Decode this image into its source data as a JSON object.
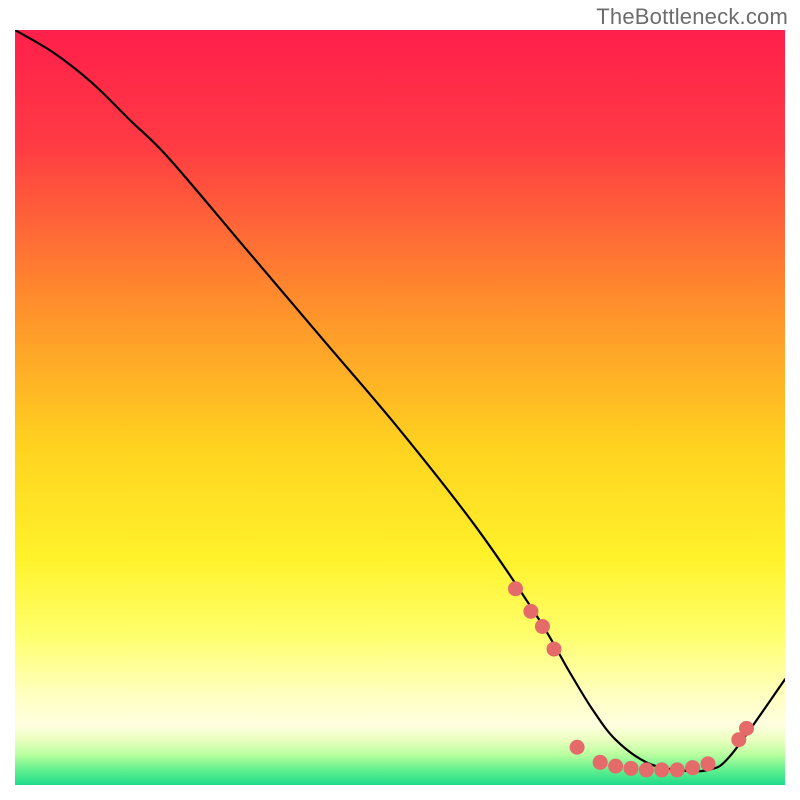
{
  "watermark": "TheBottleneck.com",
  "chart_data": {
    "type": "line",
    "title": "",
    "xlabel": "",
    "ylabel": "",
    "xlim": [
      0,
      100
    ],
    "ylim": [
      0,
      100
    ],
    "background_gradient_stops": [
      {
        "offset": 0,
        "color": "#ff1f4b"
      },
      {
        "offset": 15,
        "color": "#ff3a44"
      },
      {
        "offset": 35,
        "color": "#ff8a2d"
      },
      {
        "offset": 55,
        "color": "#ffd21f"
      },
      {
        "offset": 70,
        "color": "#fff22b"
      },
      {
        "offset": 80,
        "color": "#ffff6b"
      },
      {
        "offset": 88,
        "color": "#ffffc0"
      },
      {
        "offset": 92,
        "color": "#ffffe0"
      },
      {
        "offset": 94,
        "color": "#eaffc0"
      },
      {
        "offset": 96,
        "color": "#b8ff9e"
      },
      {
        "offset": 98,
        "color": "#63f08f"
      },
      {
        "offset": 100,
        "color": "#1ddc8c"
      }
    ],
    "series": [
      {
        "name": "curve",
        "x": [
          0,
          5,
          10,
          15,
          20,
          30,
          40,
          50,
          60,
          68,
          72,
          75,
          78,
          82,
          86,
          90,
          93,
          100
        ],
        "y": [
          100,
          97,
          93,
          88,
          83,
          71,
          59,
          47,
          34,
          22,
          15,
          10,
          6,
          3,
          2,
          2,
          4,
          14
        ]
      }
    ],
    "highlight_points": {
      "name": "markers",
      "color": "#e56a6a",
      "points": [
        {
          "x": 65,
          "y": 26
        },
        {
          "x": 67,
          "y": 23
        },
        {
          "x": 68.5,
          "y": 21
        },
        {
          "x": 70,
          "y": 18
        },
        {
          "x": 73,
          "y": 5
        },
        {
          "x": 76,
          "y": 3
        },
        {
          "x": 78,
          "y": 2.5
        },
        {
          "x": 80,
          "y": 2.2
        },
        {
          "x": 82,
          "y": 2
        },
        {
          "x": 84,
          "y": 2
        },
        {
          "x": 86,
          "y": 2
        },
        {
          "x": 88,
          "y": 2.3
        },
        {
          "x": 90,
          "y": 2.8
        },
        {
          "x": 94,
          "y": 6
        },
        {
          "x": 95,
          "y": 7.5
        }
      ]
    }
  }
}
